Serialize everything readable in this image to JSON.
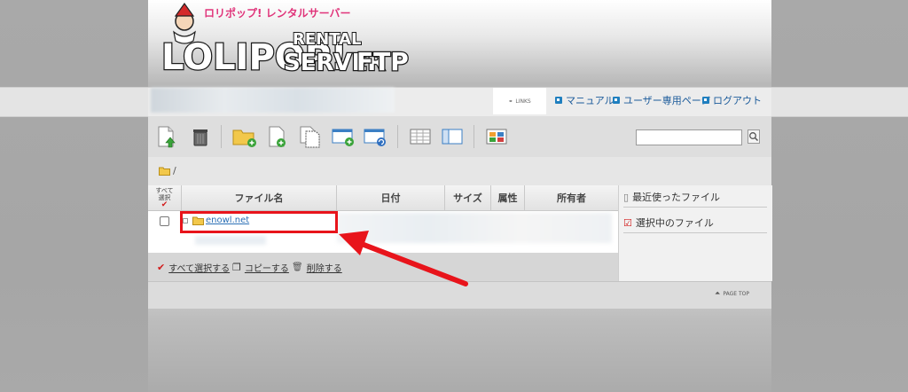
{
  "logo": {
    "main_text": "LOLIPOP!",
    "sub_top": "RENTAL",
    "sub_bottom": "SERVER",
    "ftp": "FTP",
    "badge": "ロリポップ! レンタルサーバー"
  },
  "header": {
    "links_tab": "LINKS",
    "links": [
      "マニュアル",
      "ユーザー専用ページ",
      "ログアウト"
    ]
  },
  "toolbar": {
    "icons": [
      "upload-icon",
      "trash-icon",
      "new-folder-icon",
      "new-file-icon",
      "copy-file-icon",
      "window-add-icon",
      "window-refresh-icon",
      "list-view-icon",
      "split-view-icon",
      "thumbnail-view-icon"
    ],
    "search_value": ""
  },
  "path": {
    "text": "/"
  },
  "table": {
    "select_all_top": "すべて",
    "select_all_bottom": "選択",
    "columns": [
      "ファイル名",
      "日付",
      "サイズ",
      "属性",
      "所有者"
    ],
    "rows": [
      {
        "name": "enowl.net"
      }
    ]
  },
  "actions": [
    "すべて選択する",
    "コピーする",
    "削除する"
  ],
  "side_panel": [
    "最近使ったファイル",
    "選択中のファイル"
  ],
  "footer": {
    "page_top": "PAGE TOP"
  },
  "colors": {
    "accent_red": "#e8141b",
    "link_blue": "#2b6fb5",
    "folder_yellow": "#f2c84b"
  }
}
